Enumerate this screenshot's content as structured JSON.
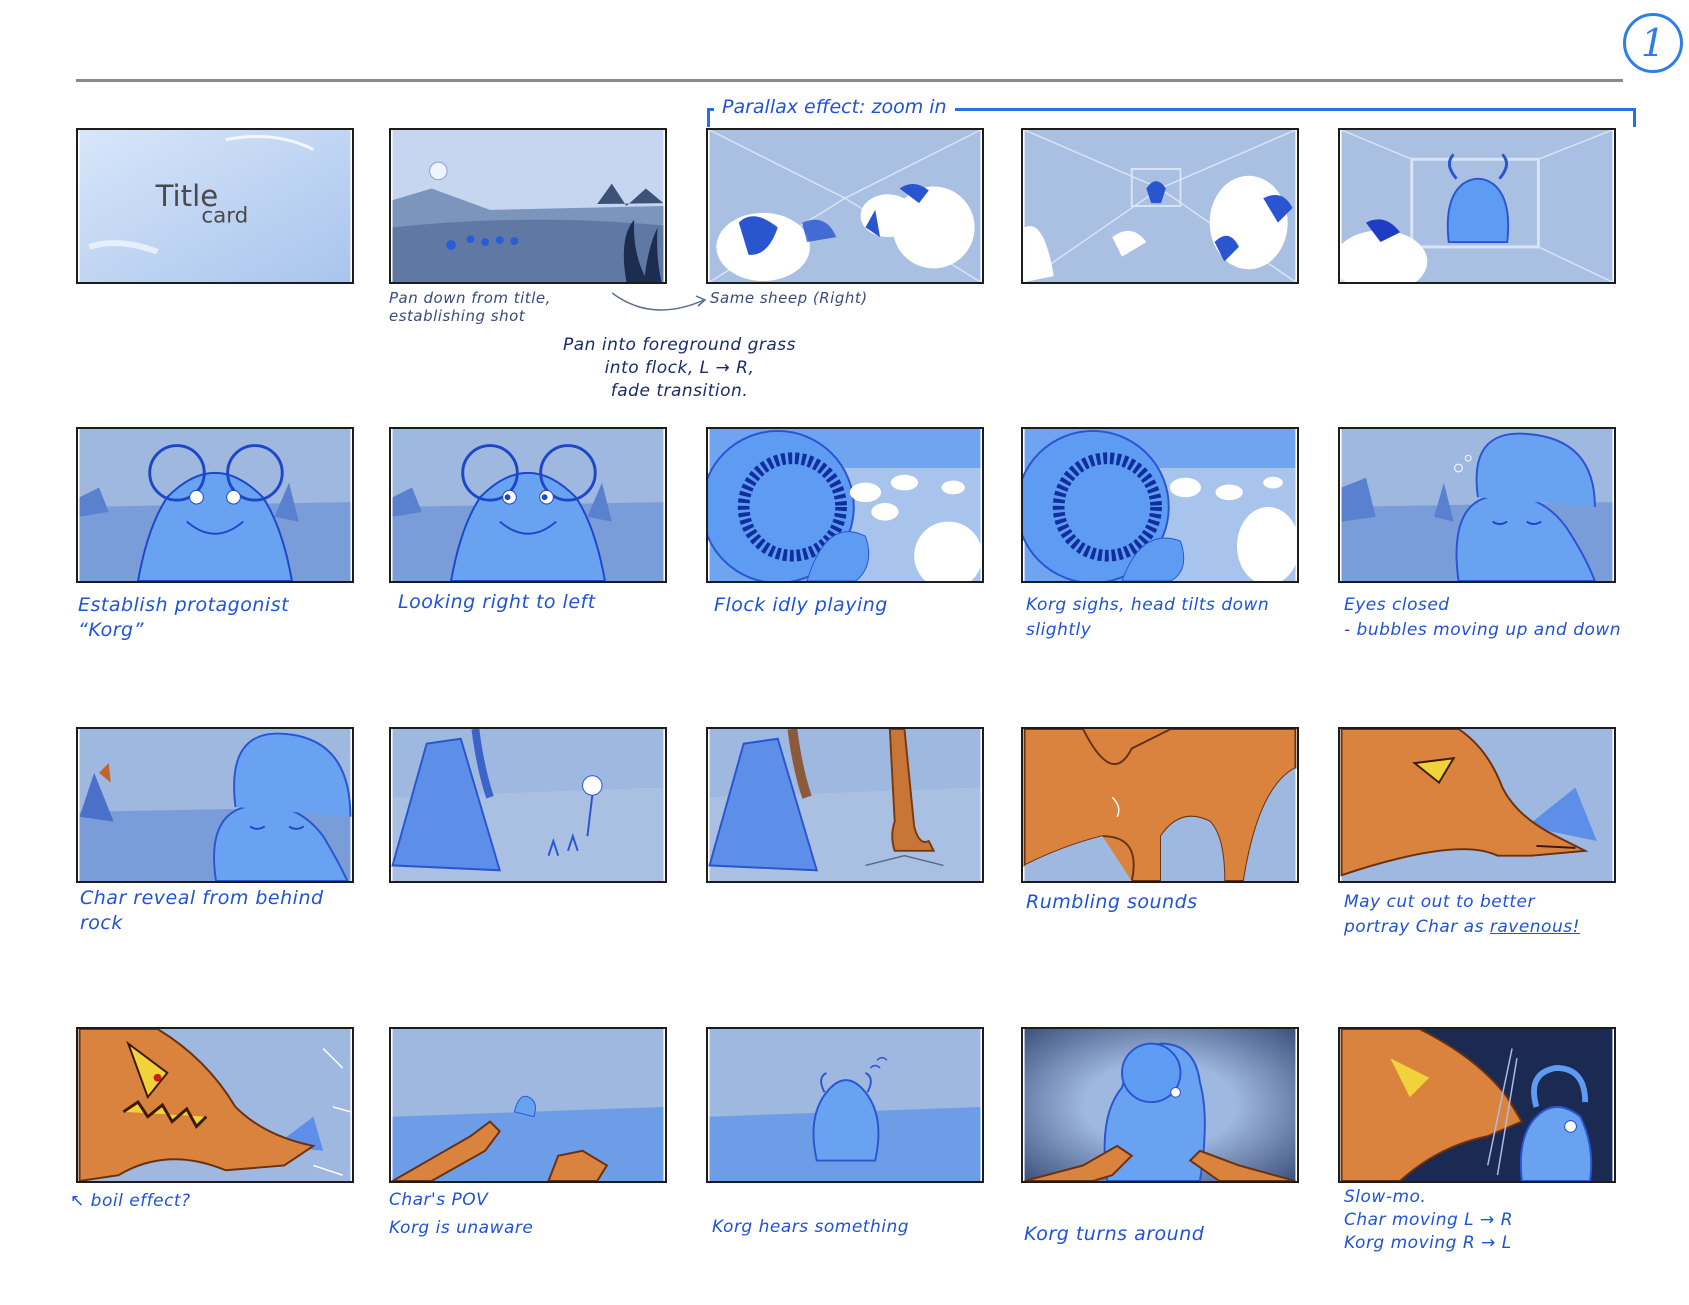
{
  "page": {
    "number": "1"
  },
  "parallax": {
    "label": "Parallax effect: zoom in"
  },
  "title_card": {
    "line1": "Title",
    "line2": "card"
  },
  "notes": {
    "p2": [
      "Pan down from title,",
      "establishing shot"
    ],
    "same_sheep": "Same sheep (Right)",
    "transition": [
      "Pan into foreground grass",
      "into flock, L → R,",
      "fade transition."
    ],
    "p6": [
      "Establish protagonist",
      "“Korg”"
    ],
    "p7": "Looking right to left",
    "p8": "Flock idly playing",
    "p9": [
      "Korg sighs, head tilts down",
      "slightly"
    ],
    "p10": [
      "Eyes closed",
      "- bubbles moving up and down"
    ],
    "p11": [
      "Char reveal from behind",
      "rock"
    ],
    "p14": "Rumbling sounds",
    "p15": [
      "May cut out to better",
      "portray Char as",
      "ravenous!"
    ],
    "p16": "↖ boil effect?",
    "p17": [
      "Char's POV",
      "Korg is unaware"
    ],
    "p18": "Korg hears something",
    "p19": "Korg turns around",
    "p20": [
      "Slow-mo.",
      "Char moving L → R",
      "Korg moving R → L"
    ]
  },
  "colors": {
    "ink_blue": "#1e52d8",
    "panel_blue_light": "#b9c9e6",
    "panel_blue_mid": "#8fb2e8",
    "character_blue": "#5d9cf2",
    "dragon_orange": "#d9833e",
    "night_navy": "#1b2a52"
  }
}
